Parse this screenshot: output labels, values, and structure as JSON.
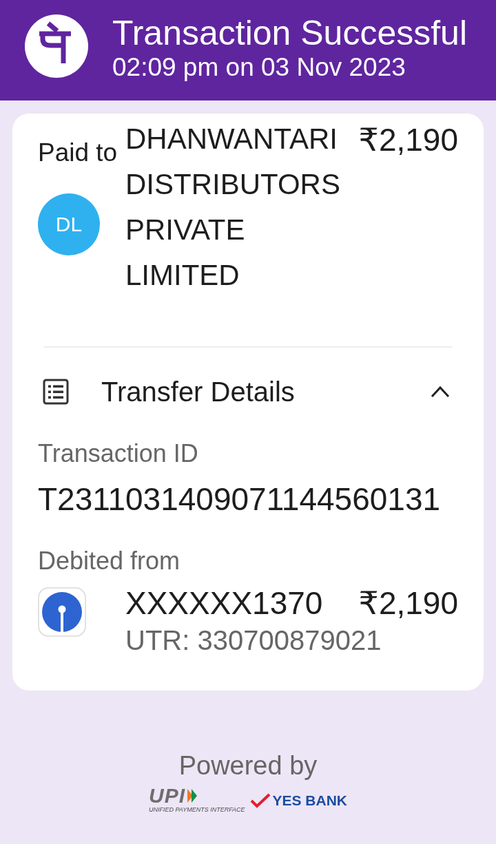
{
  "header": {
    "title": "Transaction Successful",
    "subtitle": "02:09 pm on 03 Nov 2023"
  },
  "paid_to": {
    "label": "Paid to",
    "avatar_initials": "DL",
    "name": "DHANWANTARI DISTRIBUTORS PRIVATE LIMITED",
    "amount": "₹2,190"
  },
  "transfer_details": {
    "title": "Transfer Details",
    "expanded": true,
    "transaction_id": {
      "label": "Transaction ID",
      "value": "T2311031409071144560131"
    },
    "debited_from": {
      "label": "Debited from",
      "account": "XXXXXX1370",
      "amount": "₹2,190",
      "utr": "UTR: 330700879021"
    }
  },
  "footer": {
    "powered_by": "Powered by",
    "upi_logo": {
      "wordmark": "UPI",
      "tagline": "UNIFIED PAYMENTS INTERFACE"
    },
    "bank_logo": {
      "name": "YES BANK"
    }
  }
}
